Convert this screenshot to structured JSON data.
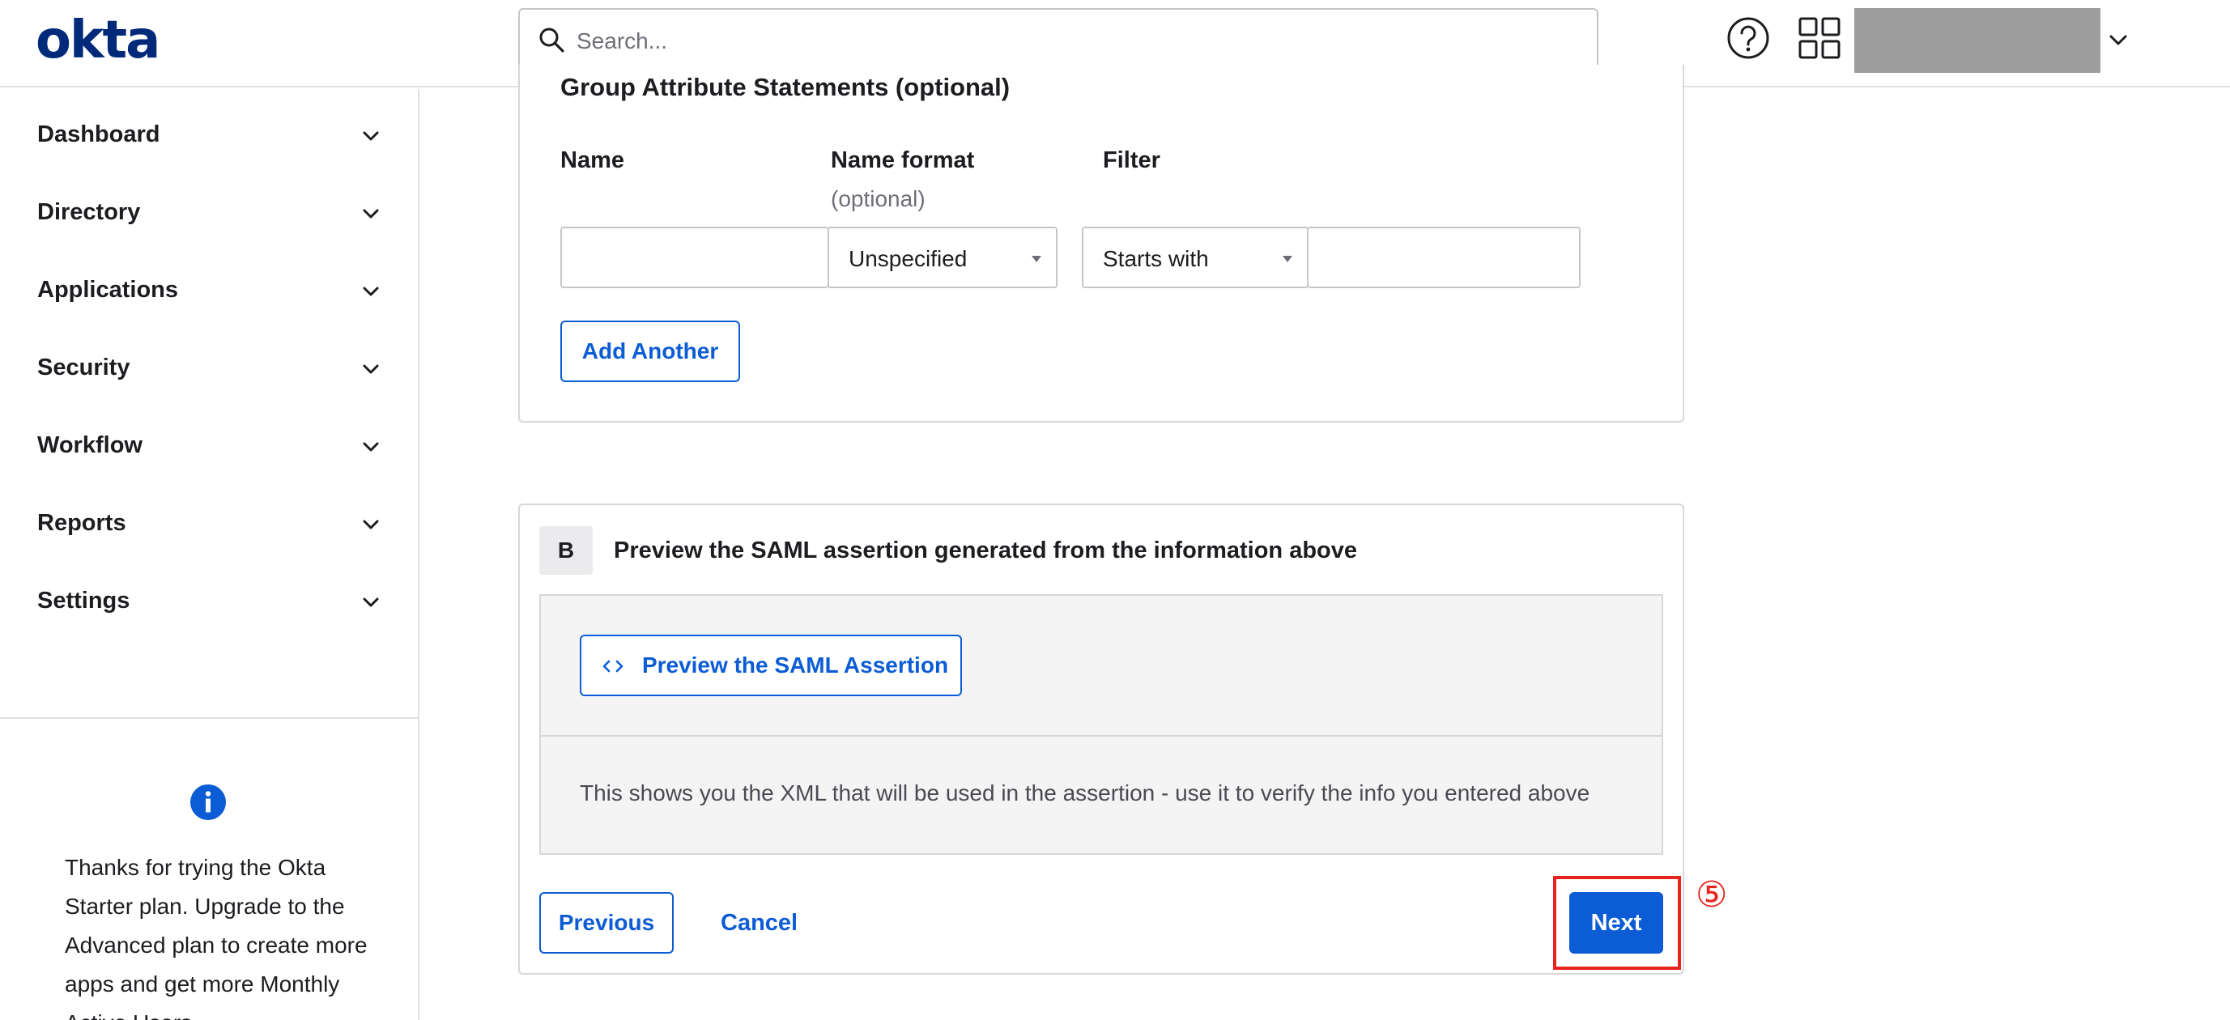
{
  "header": {
    "logo": "okta",
    "search_placeholder": "Search..."
  },
  "sidebar": {
    "items": [
      {
        "label": "Dashboard"
      },
      {
        "label": "Directory"
      },
      {
        "label": "Applications"
      },
      {
        "label": "Security"
      },
      {
        "label": "Workflow"
      },
      {
        "label": "Reports"
      },
      {
        "label": "Settings"
      }
    ],
    "promo_text": "Thanks for trying the Okta Starter plan. Upgrade to the Advanced plan to create more apps and get more Monthly Active Users"
  },
  "group_attributes": {
    "title": "Group Attribute Statements (optional)",
    "col_name": "Name",
    "col_name_format": "Name format",
    "col_name_format_sub": "(optional)",
    "col_filter": "Filter",
    "name_value": "",
    "name_format_value": "Unspecified",
    "filter_type_value": "Starts with",
    "filter_value": "",
    "add_another_label": "Add Another"
  },
  "section_b": {
    "badge": "B",
    "title": "Preview the SAML assertion generated from the information above",
    "preview_button_icon": "code-icon",
    "preview_button_label": "Preview the SAML Assertion",
    "help_text": "This shows you the XML that will be used in the assertion - use it to verify the info you entered above"
  },
  "footer_actions": {
    "previous_label": "Previous",
    "cancel_label": "Cancel",
    "next_label": "Next"
  },
  "annotation": {
    "step_number": "⑤",
    "color": "#e8231d"
  },
  "colors": {
    "brand": "#00297a",
    "primary": "#0b5cd5"
  }
}
